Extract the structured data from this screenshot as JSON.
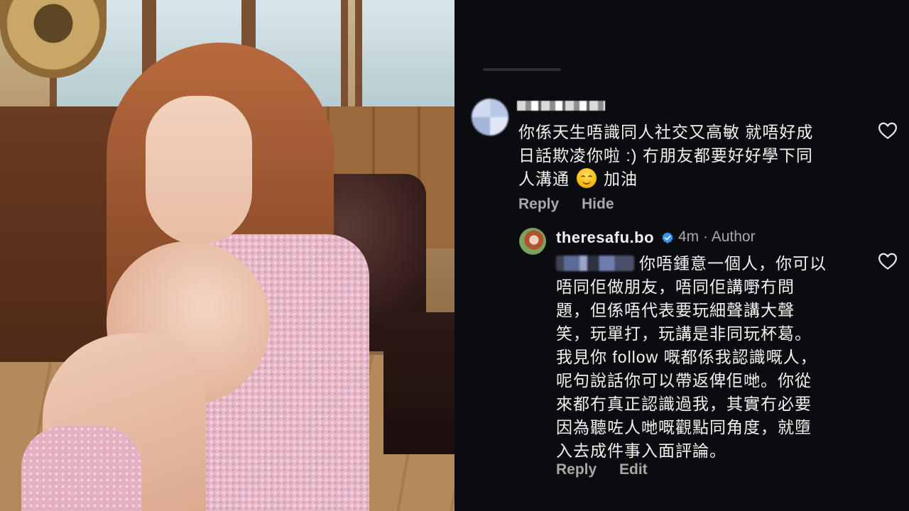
{
  "comment": {
    "lines": [
      "你係天生唔識同人社交又高敏 就唔好成",
      "日話欺凌你啦 :) 冇朋友都要好好學下同",
      "人溝通"
    ],
    "after_emoji": "加油",
    "emoji_icon": "smiling-face-icon",
    "actions": {
      "reply": "Reply",
      "hide": "Hide"
    }
  },
  "reply": {
    "username": "theresafu.bo",
    "time": "4m",
    "separator": "·",
    "badge": "Author",
    "first_line": "你唔鍾意一個人，你可以",
    "lines": [
      "唔同佢做朋友，唔同佢講嘢冇問",
      "題，但係唔代表要玩細聲講大聲",
      "笑，玩單打，玩講是非同玩杯葛。",
      "我見你 follow 嘅都係我認識嘅人，",
      "呢句說話你可以帶返俾佢哋。你從",
      "來都冇真正認識過我，其實冇必要",
      "因為聽咗人哋嘅觀點同角度，就墮",
      "入去成件事入面評論。"
    ],
    "actions": {
      "reply": "Reply",
      "edit": "Edit"
    }
  },
  "colors": {
    "panel_bg": "#0b0c10",
    "text": "#f2f2f2",
    "muted": "#a8a8a8",
    "verified": "#3797f0"
  }
}
